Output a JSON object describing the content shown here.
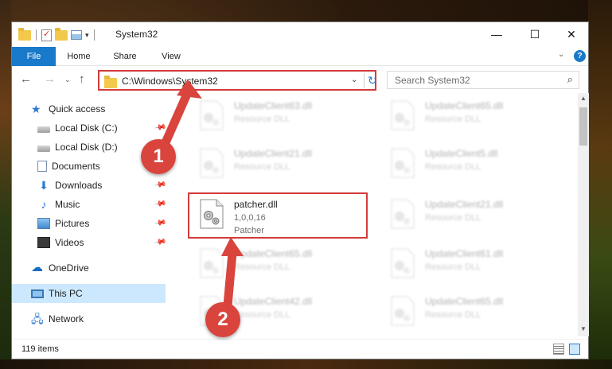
{
  "window": {
    "title": "System32",
    "controls": {
      "minimize": "—",
      "maximize": "☐",
      "close": "✕"
    }
  },
  "ribbon": {
    "tabs": [
      {
        "label": "File",
        "active": true
      },
      {
        "label": "Home"
      },
      {
        "label": "Share"
      },
      {
        "label": "View"
      }
    ],
    "help": "?",
    "expand": "⌄"
  },
  "nav": {
    "back": "←",
    "forward": "→",
    "recent": "⌄",
    "up": "↑",
    "address": "C:\\Windows\\System32",
    "address_drop": "⌄",
    "refresh": "↻",
    "search_placeholder": "Search System32",
    "search_icon": "⌕"
  },
  "sidebar": {
    "items": [
      {
        "label": "Quick access",
        "icon": "star-icon",
        "pinned": false
      },
      {
        "label": "Local Disk (C:)",
        "icon": "disk-icon",
        "pinned": true
      },
      {
        "label": "Local Disk (D:)",
        "icon": "disk-icon",
        "pinned": false
      },
      {
        "label": "Documents",
        "icon": "document-icon",
        "pinned": true
      },
      {
        "label": "Downloads",
        "icon": "download-icon",
        "pinned": true
      },
      {
        "label": "Music",
        "icon": "music-icon",
        "pinned": true
      },
      {
        "label": "Pictures",
        "icon": "picture-icon",
        "pinned": true
      },
      {
        "label": "Videos",
        "icon": "video-icon",
        "pinned": true
      },
      {
        "label": "OneDrive",
        "icon": "cloud-icon",
        "pinned": false
      },
      {
        "label": "This PC",
        "icon": "computer-icon",
        "pinned": false,
        "selected": true
      },
      {
        "label": "Network",
        "icon": "network-icon",
        "pinned": false
      }
    ],
    "pin_glyph": "📌"
  },
  "files": [
    {
      "name": "UpdateClient63.dll",
      "line1": "Resource DLL",
      "line2": ""
    },
    {
      "name": "UpdateClient65.dll",
      "line1": "Resource DLL",
      "line2": ""
    },
    {
      "name": "UpdateClient21.dll",
      "line1": "Resource DLL",
      "line2": ""
    },
    {
      "name": "UpdateClient5.dll",
      "line1": "Resource DLL",
      "line2": ""
    },
    {
      "name": "patcher.dll",
      "line1": "1,0,0,16",
      "line2": "Patcher",
      "highlighted": true
    },
    {
      "name": "UpdateClient21.dll",
      "line1": "Resource DLL",
      "line2": ""
    },
    {
      "name": "UpdateClient65.dll",
      "line1": "Resource DLL",
      "line2": ""
    },
    {
      "name": "UpdateClient61.dll",
      "line1": "Resource DLL",
      "line2": ""
    },
    {
      "name": "UpdateClient42.dll",
      "line1": "Resource DLL",
      "line2": ""
    },
    {
      "name": "UpdateClient65.dll",
      "line1": "Resource DLL",
      "line2": ""
    }
  ],
  "status": {
    "item_count": "119 items"
  },
  "annotations": {
    "step1": "1",
    "step2": "2",
    "color": "#d9453d"
  },
  "colors": {
    "accent": "#1979ca",
    "highlight": "#d33b3b",
    "selection": "#cce8ff"
  }
}
